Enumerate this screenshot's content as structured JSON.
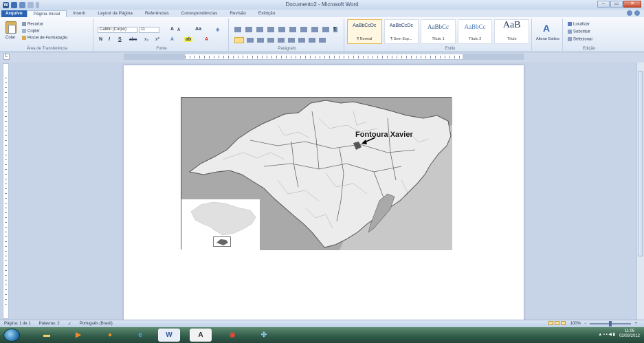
{
  "window": {
    "title": "Documento2 - Microsoft Word",
    "buttons": {
      "minimize": "–",
      "maximize": "▭",
      "close": "✕"
    }
  },
  "tabs": [
    "Arquivo",
    "Página Inicial",
    "Inserir",
    "Layout da Página",
    "Referências",
    "Correspondências",
    "Revisão",
    "Exibição"
  ],
  "active_tab": "Página Inicial",
  "ribbon": {
    "clipboard": {
      "paste": "Colar",
      "cut": "Recortar",
      "copy": "Copiar",
      "format_painter": "Pincel de Formatação",
      "label": "Área de Transferência"
    },
    "font": {
      "font_name": "Calibri (Corpo)",
      "font_size": "11",
      "grow": "A",
      "shrink": "A",
      "change_case": "Aa",
      "bold": "N",
      "italic": "I",
      "underline": "S",
      "strike": "abc",
      "subscript": "x₂",
      "superscript": "x²",
      "label": "Fonte"
    },
    "paragraph": {
      "label": "Parágrafo"
    },
    "styles": {
      "items": [
        {
          "preview": "AaBbCcDc",
          "name": "¶ Normal"
        },
        {
          "preview": "AaBbCcDc",
          "name": "¶ Sem Esp..."
        },
        {
          "preview": "AaBbCc",
          "name": "Título 1"
        },
        {
          "preview": "AaBbCc",
          "name": "Título 2"
        },
        {
          "preview": "AaB",
          "name": "Título"
        }
      ],
      "change_styles": "Alterar Estilos",
      "label": "Estilo"
    },
    "editing": {
      "find": "Localizar",
      "replace": "Substituir",
      "select": "Selecionar",
      "label": "Edição"
    }
  },
  "document": {
    "map_label": "Fontoura Xavier"
  },
  "status_bar": {
    "page": "Página: 1 de 1",
    "words": "Palavras: 2",
    "language": "Português (Brasil)",
    "zoom": "100%"
  },
  "taskbar": {
    "time": "11:05",
    "date": "03/09/2012"
  },
  "colors": {
    "file_tab": "#2a63b4",
    "map_land": "#e9e9e9",
    "map_outside": "#a9a9a9",
    "taskbar": "#2f5a48"
  }
}
